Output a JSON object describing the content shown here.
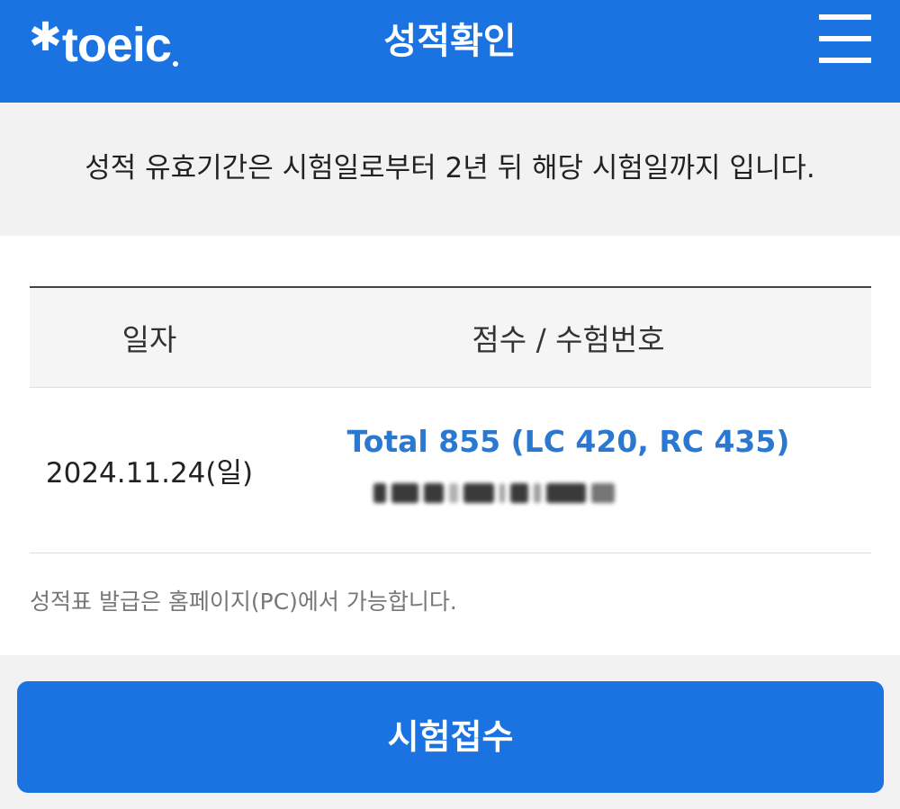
{
  "header": {
    "logo_text": "toeic",
    "title": "성적확인",
    "menu_icon": "hamburger-menu-icon",
    "brand_color": "#1a73e0"
  },
  "notice": {
    "text": "성적 유효기간은 시험일로부터 2년 뒤 해당 시험일까지 입니다."
  },
  "score_table": {
    "columns": [
      "일자",
      "점수 / 수험번호"
    ],
    "rows": [
      {
        "date": "2024.11.24(일)",
        "score": "Total 855 (LC 420, RC 435)"
      }
    ],
    "score_color": "#2a78cf"
  },
  "footnote": "성적표 발급은 홈페이지(PC)에서 가능합니다.",
  "cta": {
    "label": "시험접수"
  }
}
